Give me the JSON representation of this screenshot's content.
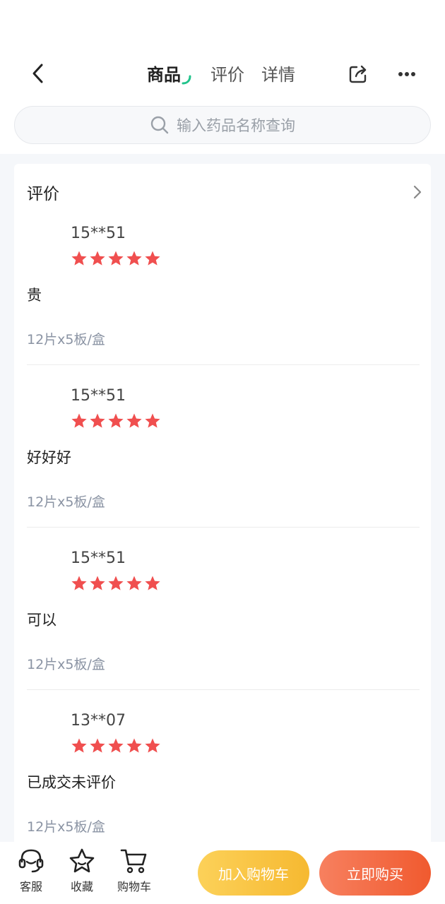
{
  "header": {
    "tabs": [
      {
        "label": "商品",
        "active": true
      },
      {
        "label": "评价",
        "active": false
      },
      {
        "label": "详情",
        "active": false
      }
    ],
    "accent_color": "#21c38b"
  },
  "search": {
    "placeholder": "输入药品名称查询"
  },
  "reviews_section": {
    "title": "评价",
    "reviews": [
      {
        "user": "15**51",
        "rating": 5,
        "content": "贵",
        "spec": "12片x5板/盒"
      },
      {
        "user": "15**51",
        "rating": 5,
        "content": "好好好",
        "spec": "12片x5板/盒"
      },
      {
        "user": "15**51",
        "rating": 5,
        "content": "可以",
        "spec": "12片x5板/盒"
      },
      {
        "user": "13**07",
        "rating": 5,
        "content": "已成交未评价",
        "spec": "12片x5板/盒"
      }
    ],
    "star_color": "#f04f4f"
  },
  "bottom_bar": {
    "service_label": "客服",
    "favorite_label": "收藏",
    "cart_label": "购物车",
    "add_to_cart_label": "加入购物车",
    "buy_now_label": "立即购买"
  }
}
